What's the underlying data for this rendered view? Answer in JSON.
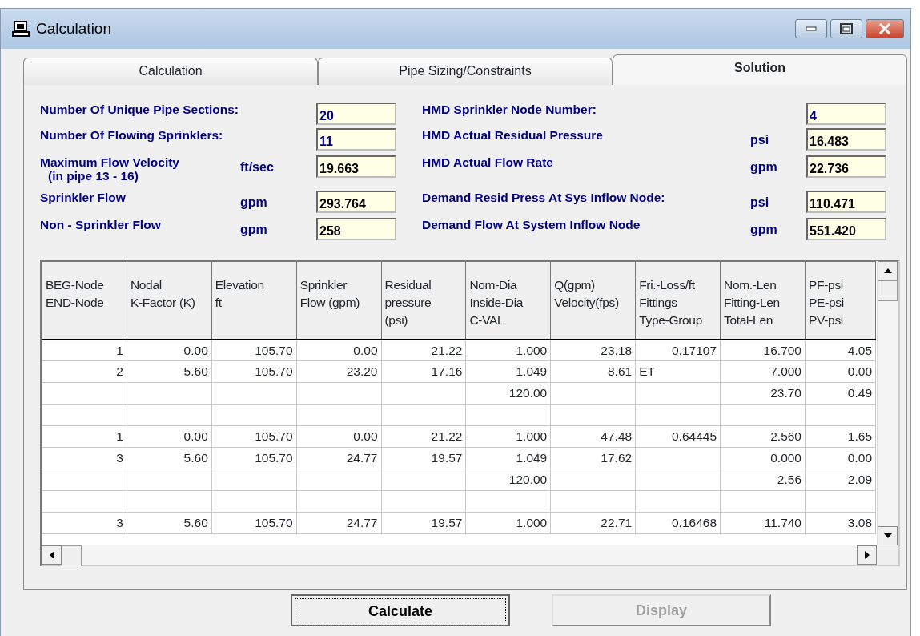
{
  "window": {
    "title": "Calculation"
  },
  "tabs": [
    {
      "label": "Calculation",
      "selected": false
    },
    {
      "label": "Pipe Sizing/Constraints",
      "selected": false
    },
    {
      "label": "Solution",
      "selected": true
    }
  ],
  "summary": {
    "left": [
      {
        "label": "Number Of Unique Pipe Sections:",
        "value": "20",
        "color": "#000080"
      },
      {
        "label": "Number Of Flowing Sprinklers:",
        "value": "11",
        "color": "#000080"
      },
      {
        "label": "Maximum Flow Velocity",
        "note": "(in pipe 13 - 16)",
        "unit": "ft/sec",
        "value": "19.663",
        "color": "#000000"
      },
      {
        "label": "Sprinkler Flow",
        "unit": "gpm",
        "value": "293.764",
        "color": "#000000"
      },
      {
        "label": "Non - Sprinkler Flow",
        "unit": "gpm",
        "value": "258",
        "color": "#000000"
      }
    ],
    "right": [
      {
        "label": "HMD Sprinkler Node Number:",
        "value": "4",
        "color": "#000080"
      },
      {
        "label": "HMD Actual Residual Pressure",
        "unit": "psi",
        "value": "16.483",
        "color": "#000000"
      },
      {
        "label": "HMD Actual Flow Rate",
        "unit": "gpm",
        "value": "22.736",
        "color": "#000000"
      },
      {
        "label": "Demand Resid Press At Sys Inflow Node:",
        "unit": "psi",
        "value": "110.471",
        "color": "#000000"
      },
      {
        "label": "Demand Flow At System Inflow Node",
        "unit": "gpm",
        "value": "551.420",
        "color": "#000000"
      }
    ]
  },
  "table": {
    "columns": [
      "BEG-Node\nEND-Node",
      "Nodal\nK-Factor (K)",
      "Elevation\nft",
      "Sprinkler\nFlow (gpm)",
      "Residual\npressure\n(psi)",
      "Nom-Dia\nInside-Dia\nC-VAL",
      "Q(gpm)\nVelocity(fps)",
      "Fri.-Loss/ft\nFittings\nType-Group",
      "Nom.-Len\nFitting-Len\nTotal-Len",
      "PF-psi\nPE-psi\nPV-psi"
    ],
    "rows": [
      [
        "1",
        "0.00",
        "105.70",
        "0.00",
        "21.22",
        "1.000",
        "23.18",
        "0.17107",
        "16.700",
        "4.05"
      ],
      [
        "2",
        "5.60",
        "105.70",
        "23.20",
        "17.16",
        "1.049",
        "8.61",
        {
          "text": "ET",
          "kind": "label"
        },
        "7.000",
        "0.00"
      ],
      [
        null,
        null,
        null,
        null,
        null,
        "120.00",
        null,
        null,
        "23.70",
        "0.49"
      ],
      [],
      [
        "1",
        "0.00",
        "105.70",
        "0.00",
        "21.22",
        "1.000",
        "47.48",
        "0.64445",
        "2.560",
        "1.65"
      ],
      [
        "3",
        "5.60",
        "105.70",
        "24.77",
        "19.57",
        "1.049",
        "17.62",
        null,
        "0.000",
        "0.00"
      ],
      [
        null,
        null,
        null,
        null,
        null,
        "120.00",
        null,
        null,
        "2.56",
        "2.09"
      ],
      [],
      [
        "3",
        "5.60",
        "105.70",
        "24.77",
        "19.57",
        "1.000",
        "22.71",
        "0.16468",
        "11.740",
        "3.08"
      ]
    ]
  },
  "buttons": [
    {
      "label": "Calculate",
      "disabled": false,
      "focused": true
    },
    {
      "label": "Display",
      "disabled": true,
      "focused": false
    }
  ]
}
